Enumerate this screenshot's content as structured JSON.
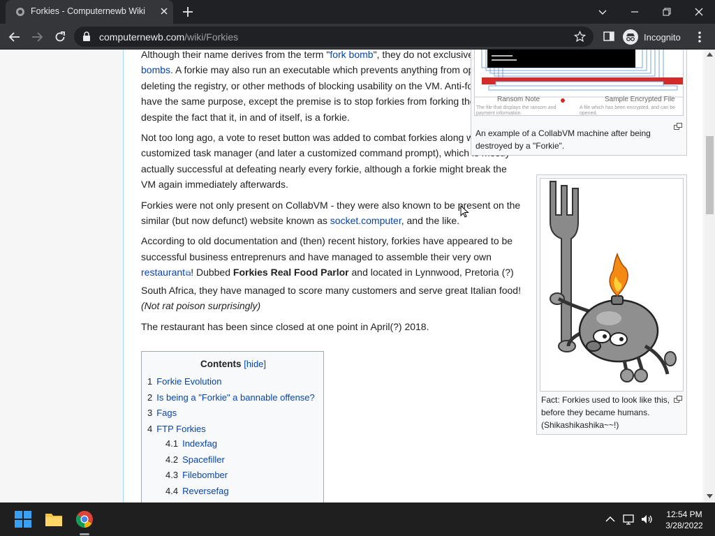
{
  "browser": {
    "tab_title": "Forkies - Computernewb Wiki",
    "url_host": "computernewb.com",
    "url_path": "/wiki/Forkies",
    "profile_label": "Incognito"
  },
  "article": {
    "p1_a": "Although their name derives from the term \"",
    "p1_link1": "fork bomb",
    "p1_b": "\", they do not exclusively run ",
    "p1_link2": "fork bombs",
    "p1_c": ". A forkie may also run an executable which prevents anything from opening, deleting the registry, or other methods of blocking usability on the VM. Anti-forkies also have the same purpose, except the premise is to stop forkies from forking the VM, despite the fact that it, in and of itself, is a forkie.",
    "p2": "Not too long ago, a vote to reset button was added to combat forkies along with a customized task manager (and later a customized command prompt), which is mostly actually successful at defeating nearly every forkie, although a forkie might break the VM again immediately afterwards.",
    "p3_a": "Forkies were not only present on CollabVM - they were also known to be present on the similar (but now defunct) website known as ",
    "p3_link": "socket.computer",
    "p3_b": ", and the like.",
    "p4_a": "According to old documentation and (then) recent history, forkies have appeared to be successful business entreprenurs and have managed to assemble their very own ",
    "p4_link": "restaurant",
    "p4_b": "! Dubbed ",
    "p4_bold": "Forkies Real Food Parlor",
    "p4_c": " and located in Lynnwood, Pretoria (?) South Africa, they have managed to score many customers and serve great Italian food! ",
    "p4_italic": "(Not rat poison surprisingly)",
    "p5": "The restaurant has been since closed at one point in April(?) 2018."
  },
  "figure1": {
    "caption": "An example of a CollabVM machine after being destroyed by a \"Forkie\".",
    "window_label_left": "Ransom Note",
    "window_label_right": "Sample Encrypted File",
    "desc_left": "The file that displays the ransom and payment information.",
    "desc_right": "A file which has been encrypted, and can be opened."
  },
  "figure2": {
    "caption": "Fact: Forkies used to look like this, before they became humans. (Shikashikashika~~!)"
  },
  "toc": {
    "title": "Contents",
    "hide": "[hide]",
    "items": [
      {
        "num": "1",
        "label": "Forkie Evolution"
      },
      {
        "num": "2",
        "label": "Is being a \"Forkie\" a bannable offense?"
      },
      {
        "num": "3",
        "label": "Fags"
      },
      {
        "num": "4",
        "label": "FTP Forkies"
      },
      {
        "num": "4.1",
        "label": "Indexfag"
      },
      {
        "num": "4.2",
        "label": "Spacefiller"
      },
      {
        "num": "4.3",
        "label": "Filebomber"
      },
      {
        "num": "4.4",
        "label": "Reversefag"
      }
    ]
  },
  "taskbar": {
    "time": "12:54 PM",
    "date": "3/28/2022"
  },
  "colors": {
    "link": "#0645ad",
    "chrome_dark": "#202124",
    "chrome_tab": "#35363a"
  }
}
